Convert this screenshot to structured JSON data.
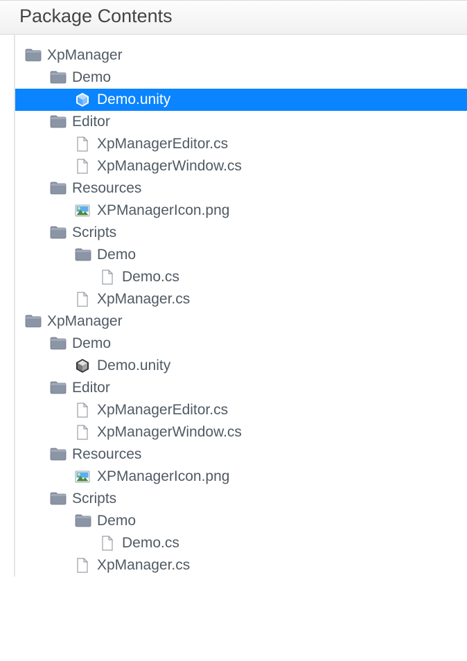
{
  "header": {
    "title": "Package Contents"
  },
  "colors": {
    "selected_bg": "#0a84ff",
    "text": "#505a64"
  },
  "tree": [
    {
      "level": 0,
      "icon": "folder",
      "label": "XpManager",
      "selected": false
    },
    {
      "level": 1,
      "icon": "folder",
      "label": "Demo",
      "selected": false
    },
    {
      "level": 2,
      "icon": "unity",
      "label": "Demo.unity",
      "selected": true
    },
    {
      "level": 1,
      "icon": "folder",
      "label": "Editor",
      "selected": false
    },
    {
      "level": 2,
      "icon": "file",
      "label": "XpManagerEditor.cs",
      "selected": false
    },
    {
      "level": 2,
      "icon": "file",
      "label": "XpManagerWindow.cs",
      "selected": false
    },
    {
      "level": 1,
      "icon": "folder",
      "label": "Resources",
      "selected": false
    },
    {
      "level": 2,
      "icon": "image",
      "label": "XPManagerIcon.png",
      "selected": false
    },
    {
      "level": 1,
      "icon": "folder",
      "label": "Scripts",
      "selected": false
    },
    {
      "level": 2,
      "icon": "folder",
      "label": "Demo",
      "selected": false
    },
    {
      "level": 3,
      "icon": "file",
      "label": "Demo.cs",
      "selected": false
    },
    {
      "level": 2,
      "icon": "file",
      "label": "XpManager.cs",
      "selected": false
    },
    {
      "level": 0,
      "icon": "folder",
      "label": "XpManager",
      "selected": false
    },
    {
      "level": 1,
      "icon": "folder",
      "label": "Demo",
      "selected": false
    },
    {
      "level": 2,
      "icon": "unity",
      "label": "Demo.unity",
      "selected": false
    },
    {
      "level": 1,
      "icon": "folder",
      "label": "Editor",
      "selected": false
    },
    {
      "level": 2,
      "icon": "file",
      "label": "XpManagerEditor.cs",
      "selected": false
    },
    {
      "level": 2,
      "icon": "file",
      "label": "XpManagerWindow.cs",
      "selected": false
    },
    {
      "level": 1,
      "icon": "folder",
      "label": "Resources",
      "selected": false
    },
    {
      "level": 2,
      "icon": "image",
      "label": "XPManagerIcon.png",
      "selected": false
    },
    {
      "level": 1,
      "icon": "folder",
      "label": "Scripts",
      "selected": false
    },
    {
      "level": 2,
      "icon": "folder",
      "label": "Demo",
      "selected": false
    },
    {
      "level": 3,
      "icon": "file",
      "label": "Demo.cs",
      "selected": false
    },
    {
      "level": 2,
      "icon": "file",
      "label": "XpManager.cs",
      "selected": false
    }
  ]
}
